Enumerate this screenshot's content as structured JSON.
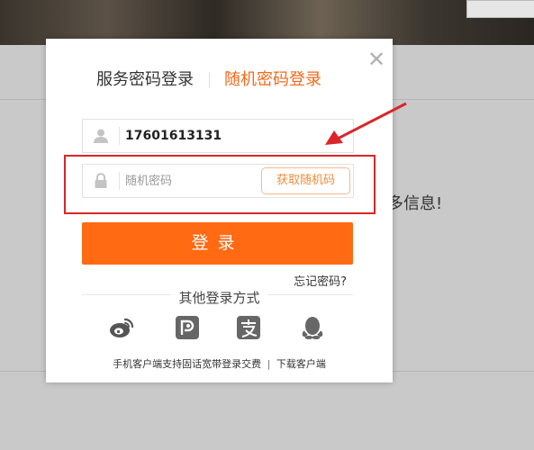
{
  "background": {
    "partial_text": "多信息!"
  },
  "dialog": {
    "close_glyph": "✕",
    "tabs": [
      {
        "label": "服务密码登录",
        "active": false
      },
      {
        "label": "随机密码登录",
        "active": true
      }
    ],
    "phone_value": "17601613131",
    "code_placeholder": "随机密码",
    "get_code_label": "获取随机码",
    "login_label": "登录",
    "forgot_label": "忘记密码?",
    "other_login_title": "其他登录方式",
    "social": [
      "weibo-icon",
      "p-icon",
      "alipay-icon",
      "qq-icon"
    ],
    "footer_text": "手机客户端支持固话宽带登录交费",
    "footer_link": "下载客户端",
    "footer_separator": "|"
  },
  "colors": {
    "accent": "#ff6a13",
    "tab_active": "#f26a1b",
    "highlight": "#d8262a"
  }
}
